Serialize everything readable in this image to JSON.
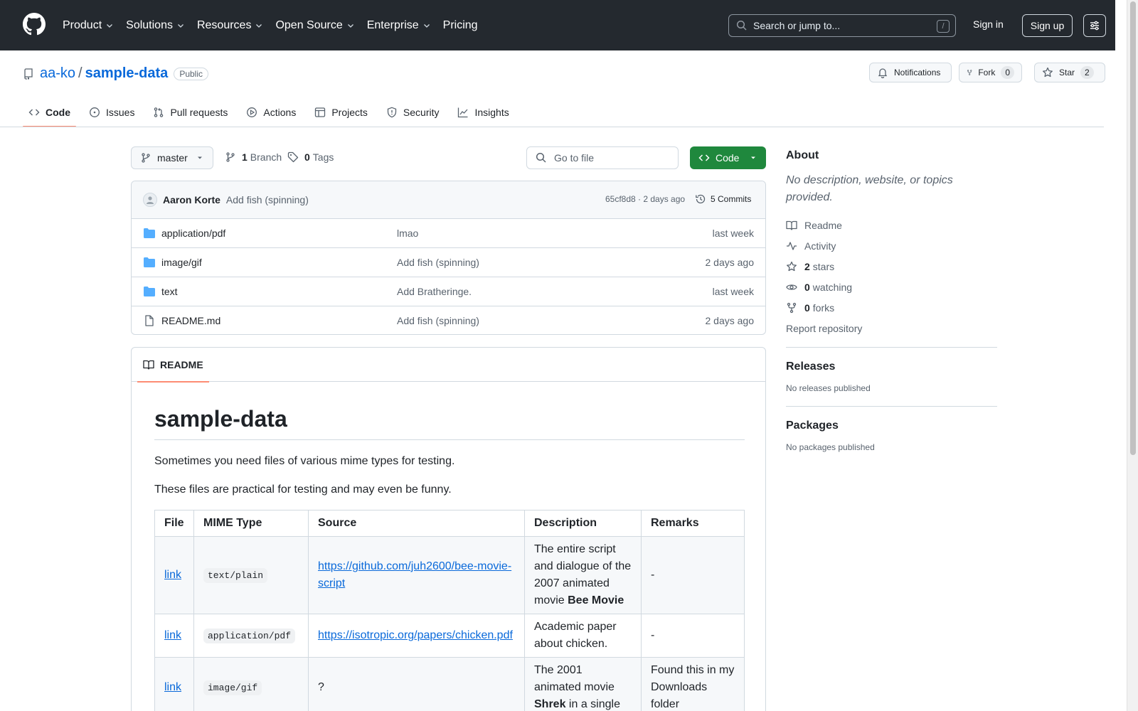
{
  "header": {
    "nav": [
      {
        "label": "Product",
        "dropdown": true
      },
      {
        "label": "Solutions",
        "dropdown": true
      },
      {
        "label": "Resources",
        "dropdown": true
      },
      {
        "label": "Open Source",
        "dropdown": true
      },
      {
        "label": "Enterprise",
        "dropdown": true
      },
      {
        "label": "Pricing",
        "dropdown": false
      }
    ],
    "search_placeholder": "Search or jump to...",
    "search_shortcut": "/",
    "signin": "Sign in",
    "signup": "Sign up"
  },
  "repo": {
    "owner": "aa-ko",
    "separator": "/",
    "name": "sample-data",
    "visibility": "Public",
    "notifications_label": "Notifications",
    "fork_label": "Fork",
    "fork_count": "0",
    "star_label": "Star",
    "star_count": "2"
  },
  "tabs": [
    {
      "label": "Code",
      "icon": "code-icon",
      "active": true
    },
    {
      "label": "Issues",
      "icon": "issue-icon"
    },
    {
      "label": "Pull requests",
      "icon": "pull-request-icon"
    },
    {
      "label": "Actions",
      "icon": "play-icon"
    },
    {
      "label": "Projects",
      "icon": "table-icon"
    },
    {
      "label": "Security",
      "icon": "shield-icon"
    },
    {
      "label": "Insights",
      "icon": "graph-icon"
    }
  ],
  "filenav": {
    "branch": "master",
    "branch_count": "1",
    "branch_label": "Branch",
    "tag_count": "0",
    "tag_label": "Tags",
    "goto_placeholder": "Go to file",
    "code_button": "Code"
  },
  "commit": {
    "author": "Aaron Korte",
    "message": "Add fish (spinning)",
    "hash_time": "65cf8d8 · 2 days ago",
    "commits": "5 Commits"
  },
  "files": [
    {
      "name": "application/pdf",
      "type": "folder",
      "message": "lmao",
      "date": "last week"
    },
    {
      "name": "image/gif",
      "type": "folder",
      "message": "Add fish (spinning)",
      "date": "2 days ago"
    },
    {
      "name": "text",
      "type": "folder",
      "message": "Add Bratheringe.",
      "date": "last week"
    },
    {
      "name": "README.md",
      "type": "file",
      "message": "Add fish (spinning)",
      "date": "2 days ago"
    }
  ],
  "readme": {
    "tab_label": "README",
    "title": "sample-data",
    "p1": "Sometimes you need files of various mime types for testing.",
    "p2": "These files are practical for testing and may even be funny.",
    "table": {
      "headers": [
        "File",
        "MIME Type",
        "Source",
        "Description",
        "Remarks"
      ],
      "rows": [
        {
          "file": "link",
          "mime": "text/plain",
          "source": "https://github.com/juh2600/bee-movie-script",
          "desc_pre": "The entire script and dialogue of the 2007 animated movie ",
          "desc_bold": "Bee Movie",
          "desc_post": "",
          "remarks": "-"
        },
        {
          "file": "link",
          "mime": "application/pdf",
          "source": "https://isotropic.org/papers/chicken.pdf",
          "desc_pre": "Academic paper about chicken.",
          "desc_bold": "",
          "desc_post": "",
          "remarks": "-"
        },
        {
          "file": "link",
          "mime": "image/gif",
          "source": "?",
          "desc_pre": "The 2001 animated movie ",
          "desc_bold": "Shrek",
          "desc_post": " in a single",
          "remarks": "Found this in my Downloads folder"
        }
      ]
    }
  },
  "sidebar": {
    "about_title": "About",
    "description": "No description, website, or topics provided.",
    "readme": "Readme",
    "activity": "Activity",
    "stars_count": "2",
    "stars_label": "stars",
    "watching_count": "0",
    "watching_label": "watching",
    "forks_count": "0",
    "forks_label": "forks",
    "report": "Report repository",
    "releases_title": "Releases",
    "releases_text": "No releases published",
    "packages_title": "Packages",
    "packages_text": "No packages published"
  },
  "colors": {
    "header_bg": "#24292f",
    "link": "#0969da",
    "code_button": "#1f883d",
    "tab_underline": "#fd8c73",
    "folder": "#54aeff"
  }
}
